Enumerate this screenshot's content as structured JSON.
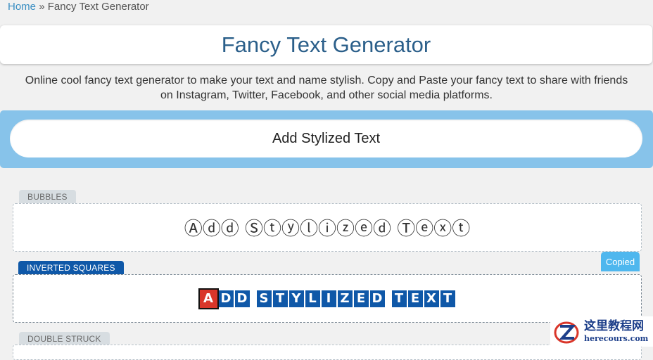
{
  "breadcrumb": {
    "home": "Home",
    "separator": "»",
    "current": "Fancy Text Generator"
  },
  "page_title": "Fancy Text Generator",
  "description": {
    "line1": "Online cool fancy text generator to make your text and name stylish. Copy and Paste your fancy text to share with friends",
    "line2": "on Instagram, Twitter, Facebook, and other social media platforms."
  },
  "input": {
    "value": "Add Stylized Text"
  },
  "styles": {
    "bubbles": {
      "label": "BUBBLES",
      "output": "Ⓐⓓⓓ Ⓢⓣⓨⓛⓘⓩⓔⓓ Ⓣⓔⓧⓣ"
    },
    "inverted_squares": {
      "label": "INVERTED SQUARES",
      "letters": [
        "A",
        "D",
        "D",
        " ",
        "S",
        "T",
        "Y",
        "L",
        "I",
        "Z",
        "E",
        "D",
        " ",
        "T",
        "E",
        "X",
        "T"
      ]
    },
    "double_struck": {
      "label": "DOUBLE STRUCK"
    }
  },
  "copied_badge": "Copied",
  "watermark": {
    "chinese": "这里教程网",
    "domain": "herecours.com"
  },
  "colors": {
    "accent_blue": "#0f58a8",
    "input_band": "#87c3ea",
    "copied_badge": "#4fb7ee",
    "title": "#2b5f8a",
    "first_letter_red": "#d9362a"
  }
}
